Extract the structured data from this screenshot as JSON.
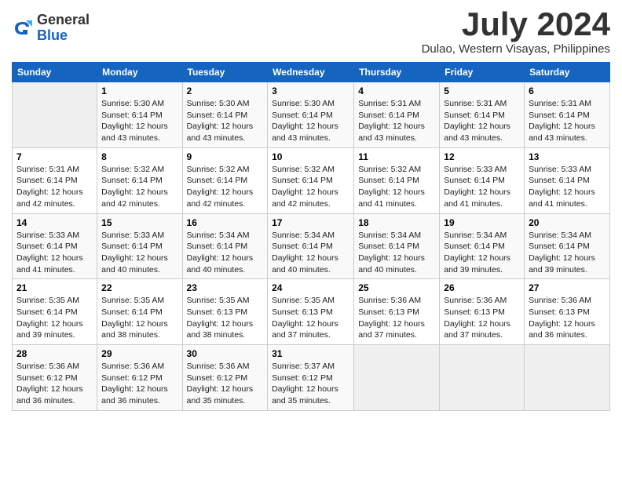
{
  "logo": {
    "general": "General",
    "blue": "Blue"
  },
  "title": "July 2024",
  "location": "Dulao, Western Visayas, Philippines",
  "days_of_week": [
    "Sunday",
    "Monday",
    "Tuesday",
    "Wednesday",
    "Thursday",
    "Friday",
    "Saturday"
  ],
  "weeks": [
    [
      {
        "day": "",
        "info": ""
      },
      {
        "day": "1",
        "info": "Sunrise: 5:30 AM\nSunset: 6:14 PM\nDaylight: 12 hours\nand 43 minutes."
      },
      {
        "day": "2",
        "info": "Sunrise: 5:30 AM\nSunset: 6:14 PM\nDaylight: 12 hours\nand 43 minutes."
      },
      {
        "day": "3",
        "info": "Sunrise: 5:30 AM\nSunset: 6:14 PM\nDaylight: 12 hours\nand 43 minutes."
      },
      {
        "day": "4",
        "info": "Sunrise: 5:31 AM\nSunset: 6:14 PM\nDaylight: 12 hours\nand 43 minutes."
      },
      {
        "day": "5",
        "info": "Sunrise: 5:31 AM\nSunset: 6:14 PM\nDaylight: 12 hours\nand 43 minutes."
      },
      {
        "day": "6",
        "info": "Sunrise: 5:31 AM\nSunset: 6:14 PM\nDaylight: 12 hours\nand 43 minutes."
      }
    ],
    [
      {
        "day": "7",
        "info": "Sunrise: 5:31 AM\nSunset: 6:14 PM\nDaylight: 12 hours\nand 42 minutes."
      },
      {
        "day": "8",
        "info": "Sunrise: 5:32 AM\nSunset: 6:14 PM\nDaylight: 12 hours\nand 42 minutes."
      },
      {
        "day": "9",
        "info": "Sunrise: 5:32 AM\nSunset: 6:14 PM\nDaylight: 12 hours\nand 42 minutes."
      },
      {
        "day": "10",
        "info": "Sunrise: 5:32 AM\nSunset: 6:14 PM\nDaylight: 12 hours\nand 42 minutes."
      },
      {
        "day": "11",
        "info": "Sunrise: 5:32 AM\nSunset: 6:14 PM\nDaylight: 12 hours\nand 41 minutes."
      },
      {
        "day": "12",
        "info": "Sunrise: 5:33 AM\nSunset: 6:14 PM\nDaylight: 12 hours\nand 41 minutes."
      },
      {
        "day": "13",
        "info": "Sunrise: 5:33 AM\nSunset: 6:14 PM\nDaylight: 12 hours\nand 41 minutes."
      }
    ],
    [
      {
        "day": "14",
        "info": "Sunrise: 5:33 AM\nSunset: 6:14 PM\nDaylight: 12 hours\nand 41 minutes."
      },
      {
        "day": "15",
        "info": "Sunrise: 5:33 AM\nSunset: 6:14 PM\nDaylight: 12 hours\nand 40 minutes."
      },
      {
        "day": "16",
        "info": "Sunrise: 5:34 AM\nSunset: 6:14 PM\nDaylight: 12 hours\nand 40 minutes."
      },
      {
        "day": "17",
        "info": "Sunrise: 5:34 AM\nSunset: 6:14 PM\nDaylight: 12 hours\nand 40 minutes."
      },
      {
        "day": "18",
        "info": "Sunrise: 5:34 AM\nSunset: 6:14 PM\nDaylight: 12 hours\nand 40 minutes."
      },
      {
        "day": "19",
        "info": "Sunrise: 5:34 AM\nSunset: 6:14 PM\nDaylight: 12 hours\nand 39 minutes."
      },
      {
        "day": "20",
        "info": "Sunrise: 5:34 AM\nSunset: 6:14 PM\nDaylight: 12 hours\nand 39 minutes."
      }
    ],
    [
      {
        "day": "21",
        "info": "Sunrise: 5:35 AM\nSunset: 6:14 PM\nDaylight: 12 hours\nand 39 minutes."
      },
      {
        "day": "22",
        "info": "Sunrise: 5:35 AM\nSunset: 6:14 PM\nDaylight: 12 hours\nand 38 minutes."
      },
      {
        "day": "23",
        "info": "Sunrise: 5:35 AM\nSunset: 6:13 PM\nDaylight: 12 hours\nand 38 minutes."
      },
      {
        "day": "24",
        "info": "Sunrise: 5:35 AM\nSunset: 6:13 PM\nDaylight: 12 hours\nand 37 minutes."
      },
      {
        "day": "25",
        "info": "Sunrise: 5:36 AM\nSunset: 6:13 PM\nDaylight: 12 hours\nand 37 minutes."
      },
      {
        "day": "26",
        "info": "Sunrise: 5:36 AM\nSunset: 6:13 PM\nDaylight: 12 hours\nand 37 minutes."
      },
      {
        "day": "27",
        "info": "Sunrise: 5:36 AM\nSunset: 6:13 PM\nDaylight: 12 hours\nand 36 minutes."
      }
    ],
    [
      {
        "day": "28",
        "info": "Sunrise: 5:36 AM\nSunset: 6:12 PM\nDaylight: 12 hours\nand 36 minutes."
      },
      {
        "day": "29",
        "info": "Sunrise: 5:36 AM\nSunset: 6:12 PM\nDaylight: 12 hours\nand 36 minutes."
      },
      {
        "day": "30",
        "info": "Sunrise: 5:36 AM\nSunset: 6:12 PM\nDaylight: 12 hours\nand 35 minutes."
      },
      {
        "day": "31",
        "info": "Sunrise: 5:37 AM\nSunset: 6:12 PM\nDaylight: 12 hours\nand 35 minutes."
      },
      {
        "day": "",
        "info": ""
      },
      {
        "day": "",
        "info": ""
      },
      {
        "day": "",
        "info": ""
      }
    ]
  ]
}
